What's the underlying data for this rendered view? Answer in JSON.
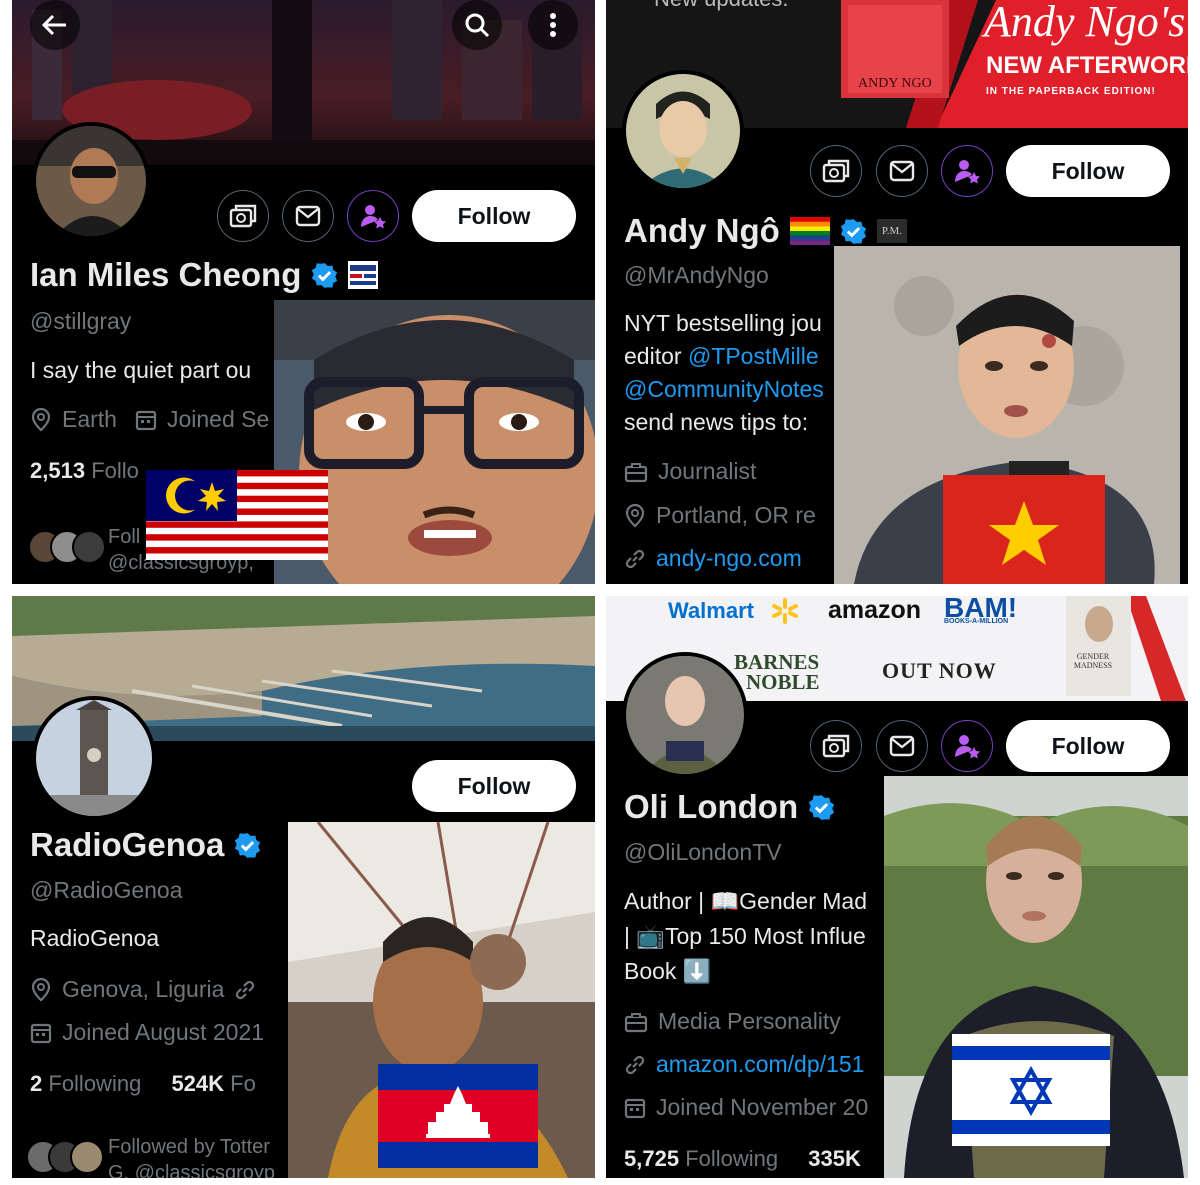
{
  "colors": {
    "background": "#000000",
    "accent": "#1d9bf0",
    "muted": "#71767b",
    "text": "#e7e9ea"
  },
  "panels": [
    {
      "name": "Ian Miles Cheong",
      "handle": "@stillgray",
      "bio": [
        "I say the quiet part ou"
      ],
      "location": "Earth",
      "joined": "Joined Se",
      "stats": {
        "following_count": "2,513",
        "following_label": "Follo",
        "followers_partial": ""
      },
      "followed_by": [
        "Foll",
        "@classicsgroyp, "
      ],
      "follow_label": "Follow",
      "flag": "malaysia",
      "badge_icon": "news-affiliate-icon"
    },
    {
      "banner_text": {
        "top": "New updates.",
        "title": "Andy Ngo's",
        "subtitle": "NEW AFTERWORD",
        "small": "IN THE PAPERBACK EDITION!",
        "book_author": "ANDY NGO"
      },
      "name": "Andy Ngô",
      "handle": "@MrAndyNgo",
      "bio": [
        "NYT bestselling jou",
        "editor ",
        "@TPostMille",
        "@CommunityNotes",
        "send news tips to:"
      ],
      "profession": "Journalist",
      "location": "Portland, OR re",
      "website": "andy-ngo.com",
      "follow_label": "Follow",
      "badge_text": "P.M.",
      "flag": "vietnam"
    },
    {
      "name": "RadioGenoa",
      "handle": "@RadioGenoa",
      "bio": [
        "RadioGenoa"
      ],
      "location": "Genova, Liguria",
      "joined": "Joined August 2021",
      "stats": {
        "following_count": "2",
        "following_label": "Following",
        "followers_count": "524K",
        "followers_label": "Fo"
      },
      "followed_by": [
        "Followed by Totter",
        "G, @classicsgroyp"
      ],
      "follow_label": "Follow",
      "flag": "cambodia"
    },
    {
      "banner_text": {
        "walmart": "Walmart",
        "amazon": "amazon",
        "bam": "BAM!",
        "bam_small": "BOOKS-A-MILLION",
        "barnes": "BARNES",
        "noble": "NOBLE",
        "out_now": "OUT NOW",
        "book_title": "GENDER MADNESS"
      },
      "name": "Oli London",
      "handle": "@OliLondonTV",
      "bio": [
        "Author | 📖Gender Mad",
        "| 📺Top 150 Most Influe",
        "Book ⬇️"
      ],
      "profession": "Media Personality",
      "website": "amazon.com/dp/151",
      "joined": "Joined November 20",
      "stats": {
        "following_count": "5,725",
        "following_label": "Following",
        "followers_count": "335K"
      },
      "follow_label": "Follow",
      "flag": "israel"
    }
  ]
}
